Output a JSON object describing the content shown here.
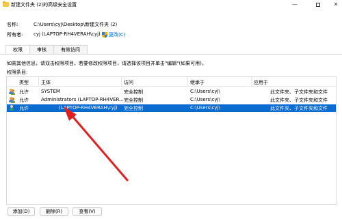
{
  "window": {
    "title": "新建文件夹 (2)的高级安全设置",
    "minimize": "—",
    "maximize": "",
    "close": "✕"
  },
  "info": {
    "name_label": "名称:",
    "name_value": "C:\\Users\\cyj\\Desktop\\新建文件夹 (2)",
    "owner_label": "所有者:",
    "owner_value": "cyj (LAPTOP-RH4VERAH\\cyj)",
    "change_link": "更改(C)"
  },
  "tabs": [
    {
      "label": "权限"
    },
    {
      "label": "审核"
    },
    {
      "label": "有效访问"
    }
  ],
  "description": "如需其他信息，请双击权限项目。若要修改权限项目，请选择该项目并单击\"编辑\"(如果可用)。",
  "entries_label": "权限条目:",
  "table": {
    "headers": [
      "类型",
      "主体",
      "访问",
      "继承于",
      "应用于"
    ],
    "rows": [
      {
        "type": "允许",
        "principal": "SYSTEM",
        "access": "完全控制",
        "inherited": "C:\\Users\\cyj\\",
        "applies": "此文件夹、子文件夹和文件",
        "icon": "group-user-icon"
      },
      {
        "type": "允许",
        "principal": "Administrators (LAPTOP-RH4VER...",
        "access": "完全控制",
        "inherited": "C:\\Users\\cyj\\",
        "applies": "此文件夹、子文件夹和文件",
        "icon": "group-user-icon"
      },
      {
        "type": "允许",
        "principal": "(LAPTOP-RH4VERAH\\cyj)",
        "access": "完全控制",
        "inherited": "C:\\Users\\cyj\\",
        "applies": "此文件夹、子文件夹和文件",
        "icon": "single-user-icon",
        "selected": true
      }
    ]
  },
  "buttons": {
    "add": "添加(D)",
    "delete": "删除(R)",
    "view": "查看(V)"
  },
  "colors": {
    "selection": "#0a6bd1",
    "link": "#0066cc",
    "annotation_arrow": "#e02020"
  }
}
